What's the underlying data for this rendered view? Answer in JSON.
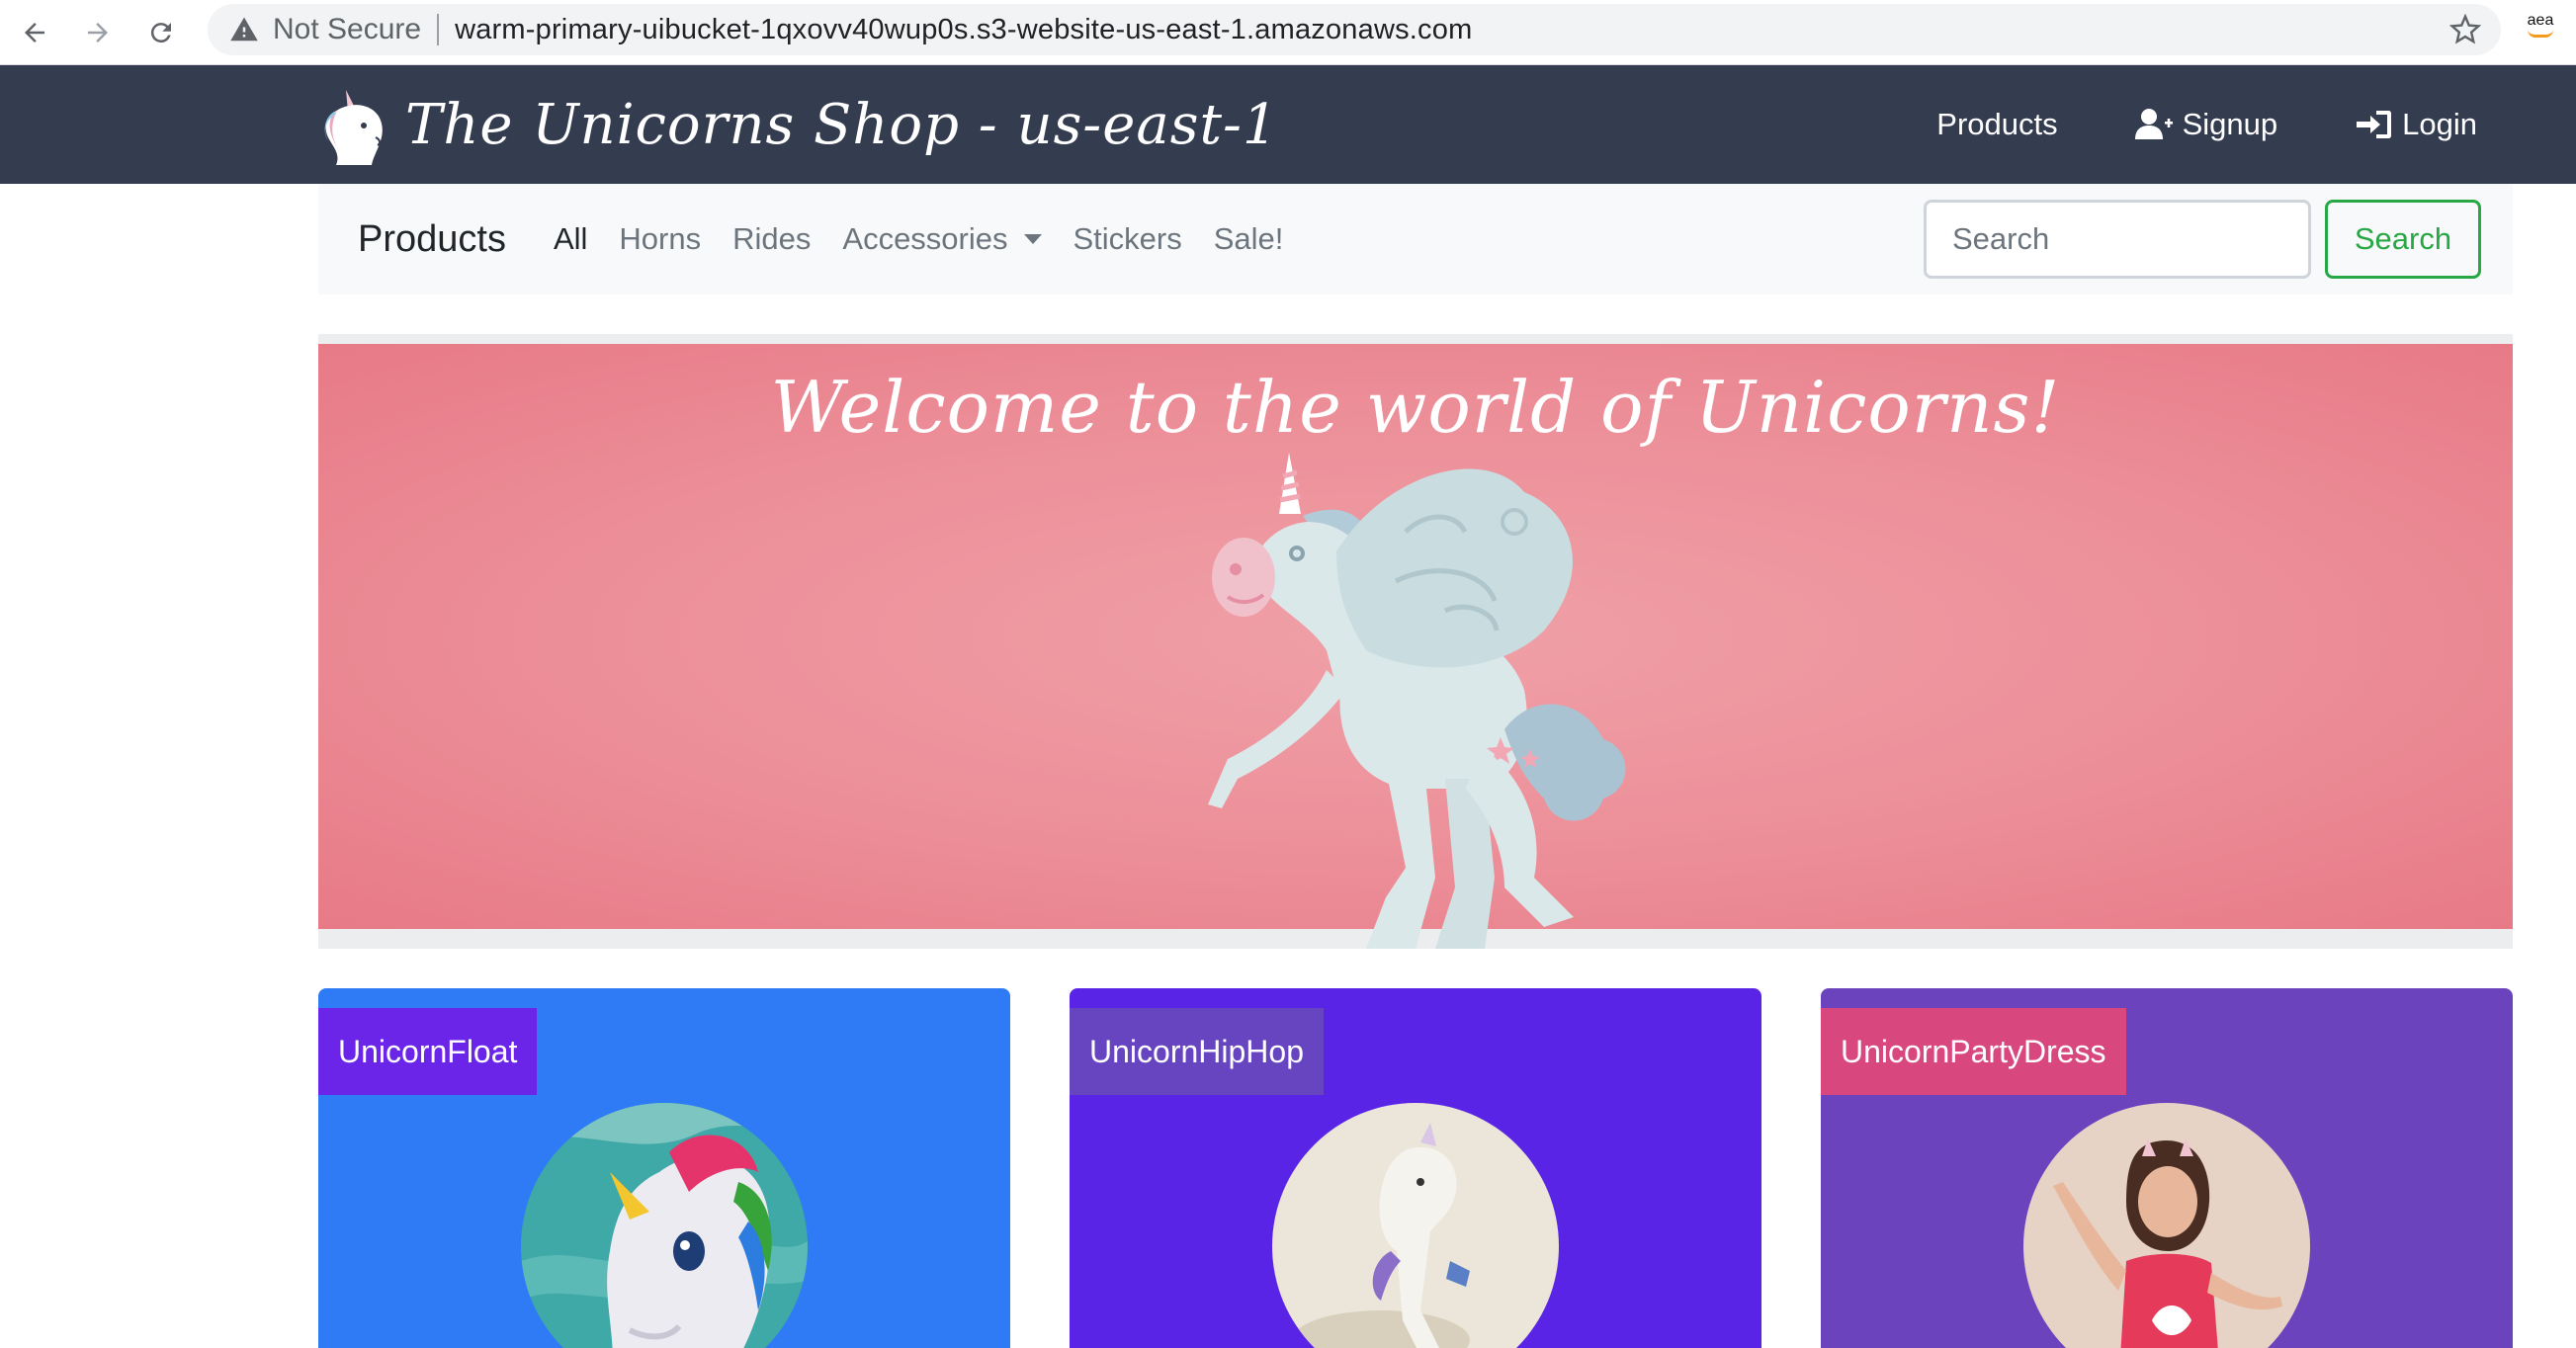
{
  "browser": {
    "security_label": "Not Secure",
    "url": "warm-primary-uibucket-1qxovv40wup0s.s3-website-us-east-1.amazonaws.com",
    "extension_label": "aea"
  },
  "navbar": {
    "brand": "The Unicorns Shop - us-east-1",
    "links": [
      {
        "label": "Products",
        "icon": "none"
      },
      {
        "label": "Signup",
        "icon": "user-plus-icon"
      },
      {
        "label": "Login",
        "icon": "sign-in-icon"
      }
    ]
  },
  "subnav": {
    "brand": "Products",
    "links": [
      "All",
      "Horns",
      "Rides",
      "Accessories",
      "Stickers",
      "Sale!"
    ],
    "active_link": "All",
    "search_placeholder": "Search",
    "search_button": "Search"
  },
  "hero": {
    "title": "Welcome to the world of Unicorns!",
    "background": "#ec8e98"
  },
  "products": [
    {
      "name": "UnicornFloat",
      "card_color": "#2f7bf5",
      "label_color": "#6a25e8"
    },
    {
      "name": "UnicornHipHop",
      "card_color": "#5a24e6",
      "label_color": "#6745c0"
    },
    {
      "name": "UnicornPartyDress",
      "card_color": "#6b43bd",
      "label_color": "#d9477f"
    }
  ],
  "colors": {
    "navbar": "#343d4f",
    "subnav": "#f8f9fa",
    "success": "#28a745"
  }
}
